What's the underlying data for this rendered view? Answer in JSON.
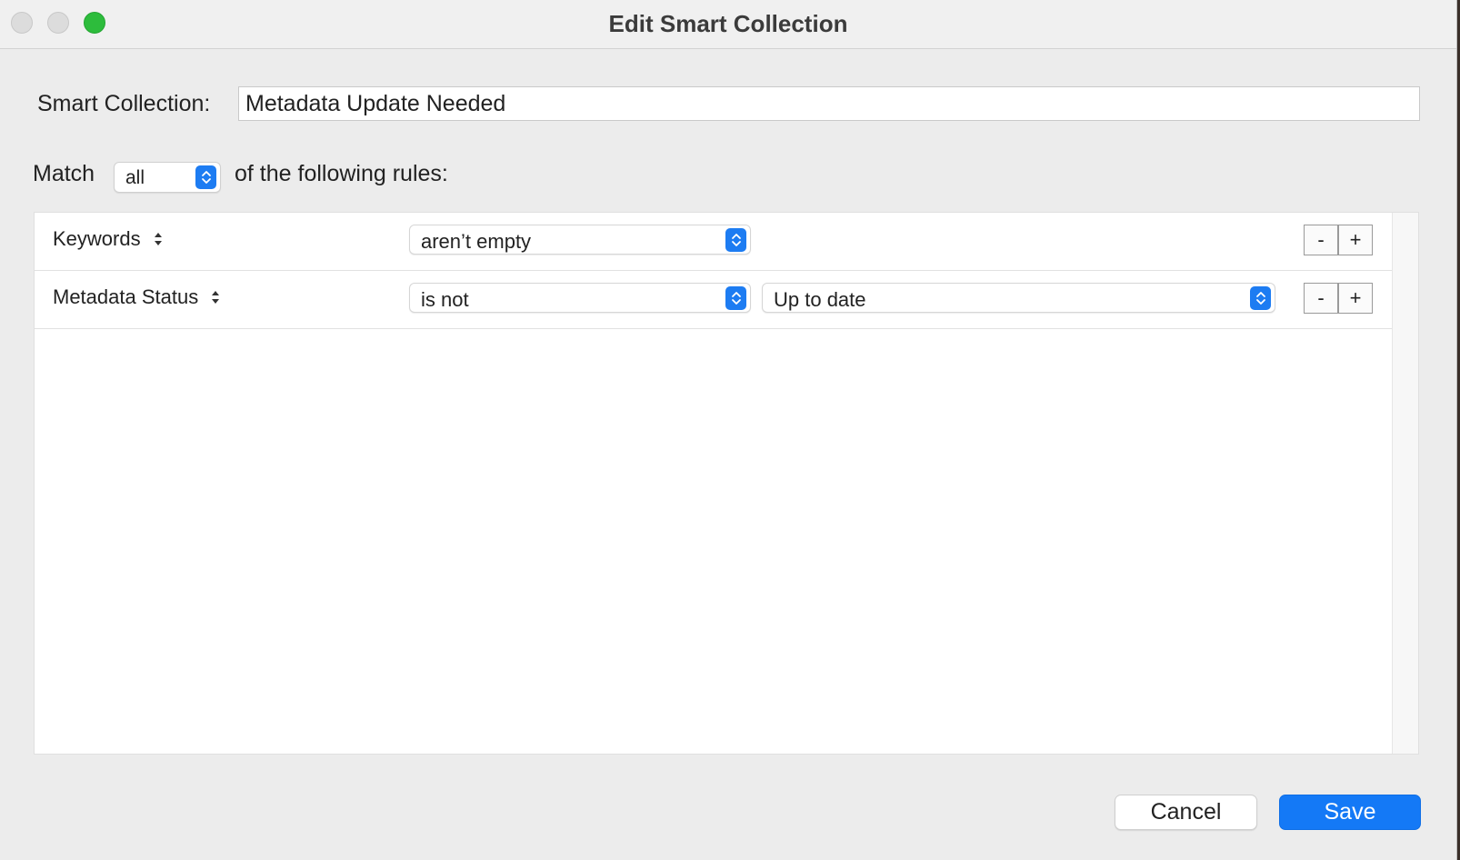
{
  "window": {
    "title": "Edit Smart Collection"
  },
  "form": {
    "name_label": "Smart Collection:",
    "name_value": "Metadata Update Needed",
    "match_label": "Match",
    "match_value": "all",
    "rules_label": "of the following rules:"
  },
  "rules": [
    {
      "field": "Keywords",
      "operator": "aren’t empty",
      "value": "",
      "remove_label": "-",
      "add_label": "+"
    },
    {
      "field": "Metadata Status",
      "operator": "is not",
      "value": "Up to date",
      "remove_label": "-",
      "add_label": "+"
    }
  ],
  "buttons": {
    "cancel": "Cancel",
    "save": "Save"
  },
  "colors": {
    "accent": "#1479f6",
    "window_bg": "#ececec",
    "close_button": "#dcdcdc",
    "zoom_button": "#2dbc3c"
  },
  "icons": {
    "popup_stepper": "up-down-chevron-icon",
    "field_arrows": "up-down-triangle-icon"
  }
}
